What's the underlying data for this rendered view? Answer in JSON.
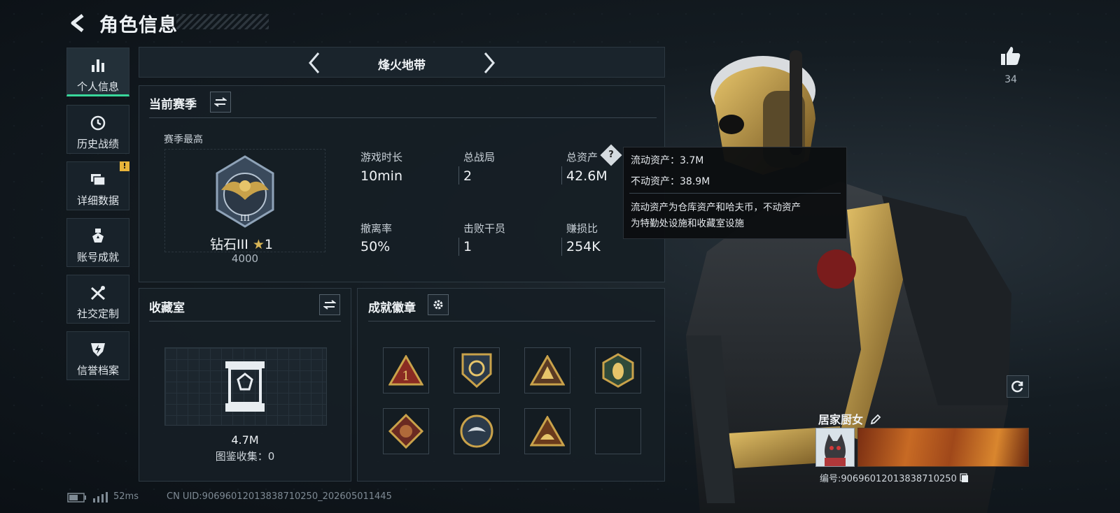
{
  "header": {
    "title": "角色信息"
  },
  "sidebar": {
    "items": [
      {
        "label": "个人信息",
        "icon": "bar-chart-icon",
        "active": true
      },
      {
        "label": "历史战绩",
        "icon": "history-icon"
      },
      {
        "label": "详细数据",
        "icon": "folder-icon",
        "badge": "!"
      },
      {
        "label": "账号成就",
        "icon": "medal-icon"
      },
      {
        "label": "社交定制",
        "icon": "tools-icon"
      },
      {
        "label": "信誉档案",
        "icon": "shield-bolt-icon"
      }
    ]
  },
  "mode_nav": {
    "label": "烽火地带"
  },
  "season": {
    "title": "当前赛季",
    "best_label": "赛季最高",
    "rank_name": "钻石III",
    "rank_stars": "1",
    "rank_score": "4000",
    "stats": [
      {
        "label": "游戏时长",
        "value": "10min"
      },
      {
        "label": "总战局",
        "value": "2"
      },
      {
        "label": "总资产",
        "value": "42.6M"
      },
      {
        "label": "撤离率",
        "value": "50%"
      },
      {
        "label": "击败干员",
        "value": "1"
      },
      {
        "label": "赚损比",
        "value": "254K"
      }
    ]
  },
  "tooltip": {
    "line1": "流动资产：3.7M",
    "line2": "不动资产：38.9M",
    "desc1": "流动资产为仓库资产和哈夫币，不动资产",
    "desc2": "为特勤处设施和收藏室设施"
  },
  "collection": {
    "title": "收藏室",
    "value": "4.7M",
    "catalog": "图鉴收集：0"
  },
  "achievements": {
    "title": "成就徽章"
  },
  "likes": {
    "count": "34"
  },
  "player": {
    "name": "居家厨女",
    "id": "编号:906960120138387102​50"
  },
  "footer": {
    "ping": "52ms",
    "uid": "CN UID:9069601201383871025​0_202605011445"
  },
  "colors": {
    "accent": "#39d89b",
    "gold": "#c9a24a",
    "warn": "#e8b43a"
  }
}
